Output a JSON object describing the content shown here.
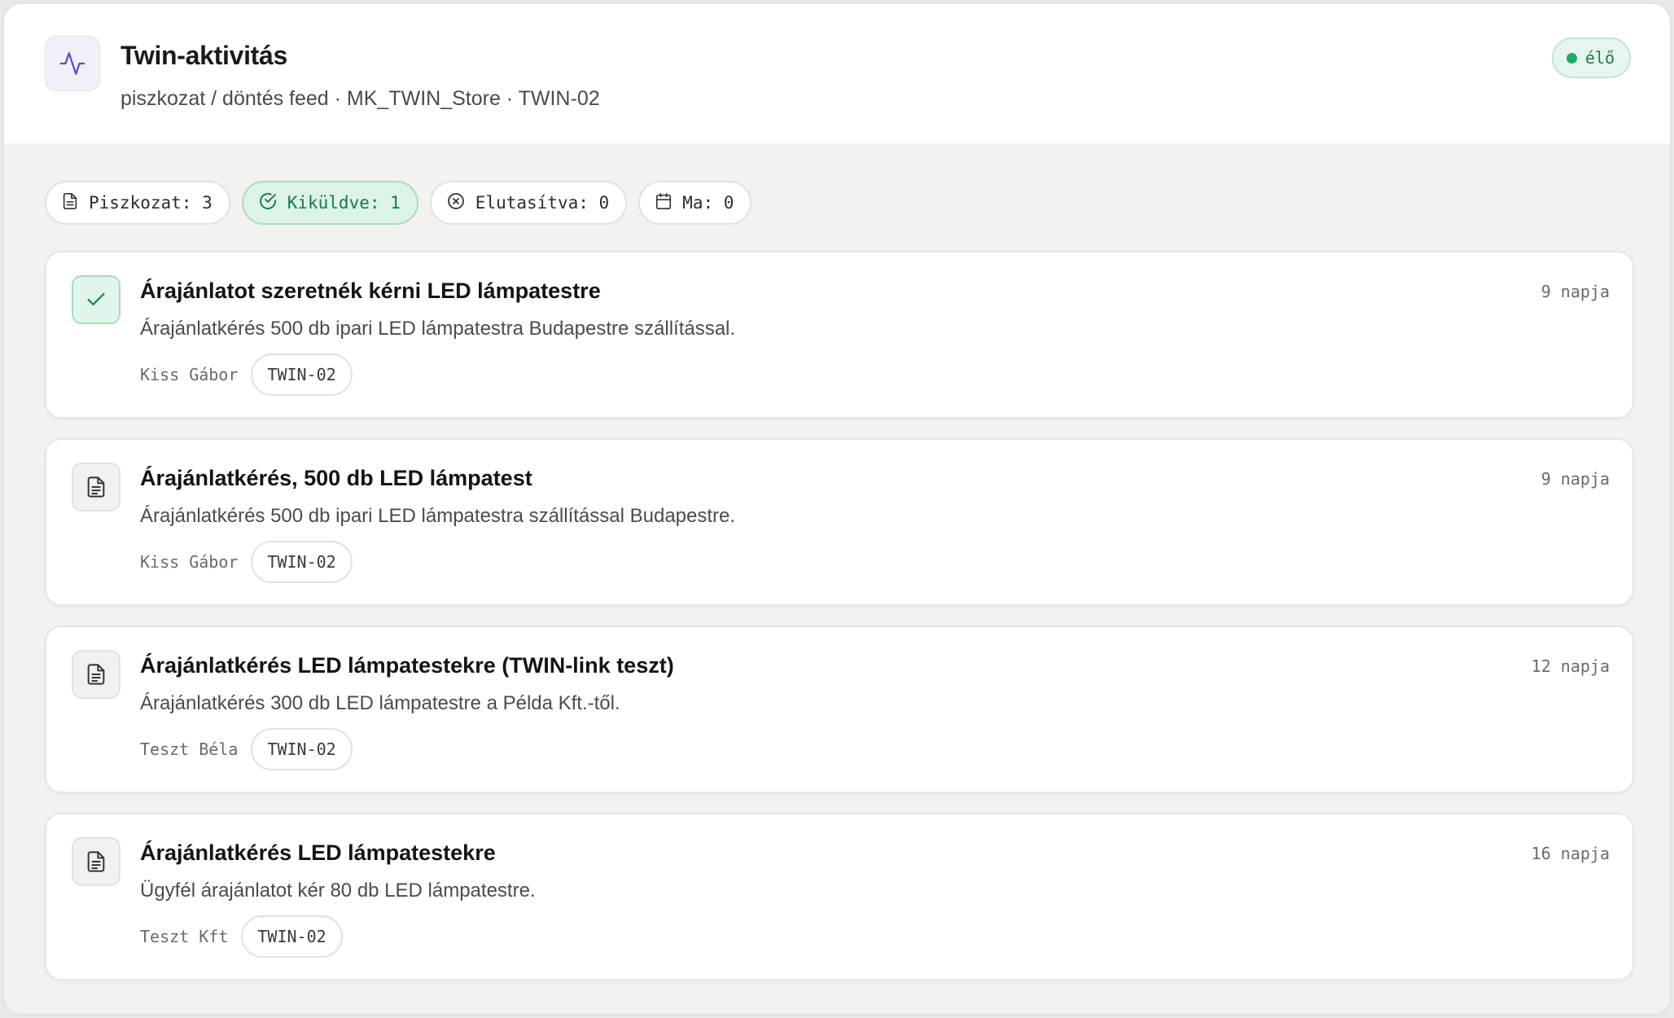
{
  "header": {
    "title": "Twin-aktivitás",
    "subtitle": "piszkozat / döntés feed · MK_TWIN_Store · TWIN-02",
    "icon": "activity-icon",
    "status_label": "élő",
    "status_color": "#1faa63"
  },
  "filters": [
    {
      "label": "Piszkozat: 3",
      "icon": "document-icon",
      "active": false
    },
    {
      "label": "Kiküldve: 1",
      "icon": "check-circle-icon",
      "active": true
    },
    {
      "label": "Elutasítva: 0",
      "icon": "x-circle-icon",
      "active": false
    },
    {
      "label": "Ma: 0",
      "icon": "calendar-icon",
      "active": false
    }
  ],
  "items": [
    {
      "status": "sent",
      "icon": "check-icon",
      "title": "Árajánlatot szeretnék kérni LED lámpatestre",
      "description": "Árajánlatkérés 500 db ipari LED lámpatestra Budapestre szállítással.",
      "author": "Kiss Gábor",
      "tag": "TWIN-02",
      "time": "9 napja"
    },
    {
      "status": "draft",
      "icon": "document-icon",
      "title": "Árajánlatkérés, 500 db LED lámpatest",
      "description": "Árajánlatkérés 500 db ipari LED lámpatestra szállítással Budapestre.",
      "author": "Kiss Gábor",
      "tag": "TWIN-02",
      "time": "9 napja"
    },
    {
      "status": "draft",
      "icon": "document-icon",
      "title": "Árajánlatkérés LED lámpatestekre (TWIN-link teszt)",
      "description": "Árajánlatkérés 300 db LED lámpatestre a Példa Kft.-től.",
      "author": "Teszt Béla",
      "tag": "TWIN-02",
      "time": "12 napja"
    },
    {
      "status": "draft",
      "icon": "document-icon",
      "title": "Árajánlatkérés LED lámpatestekre",
      "description": "Ügyfél árajánlatot kér 80 db LED lámpatestre.",
      "author": "Teszt Kft",
      "tag": "TWIN-02",
      "time": "16 napja"
    }
  ]
}
